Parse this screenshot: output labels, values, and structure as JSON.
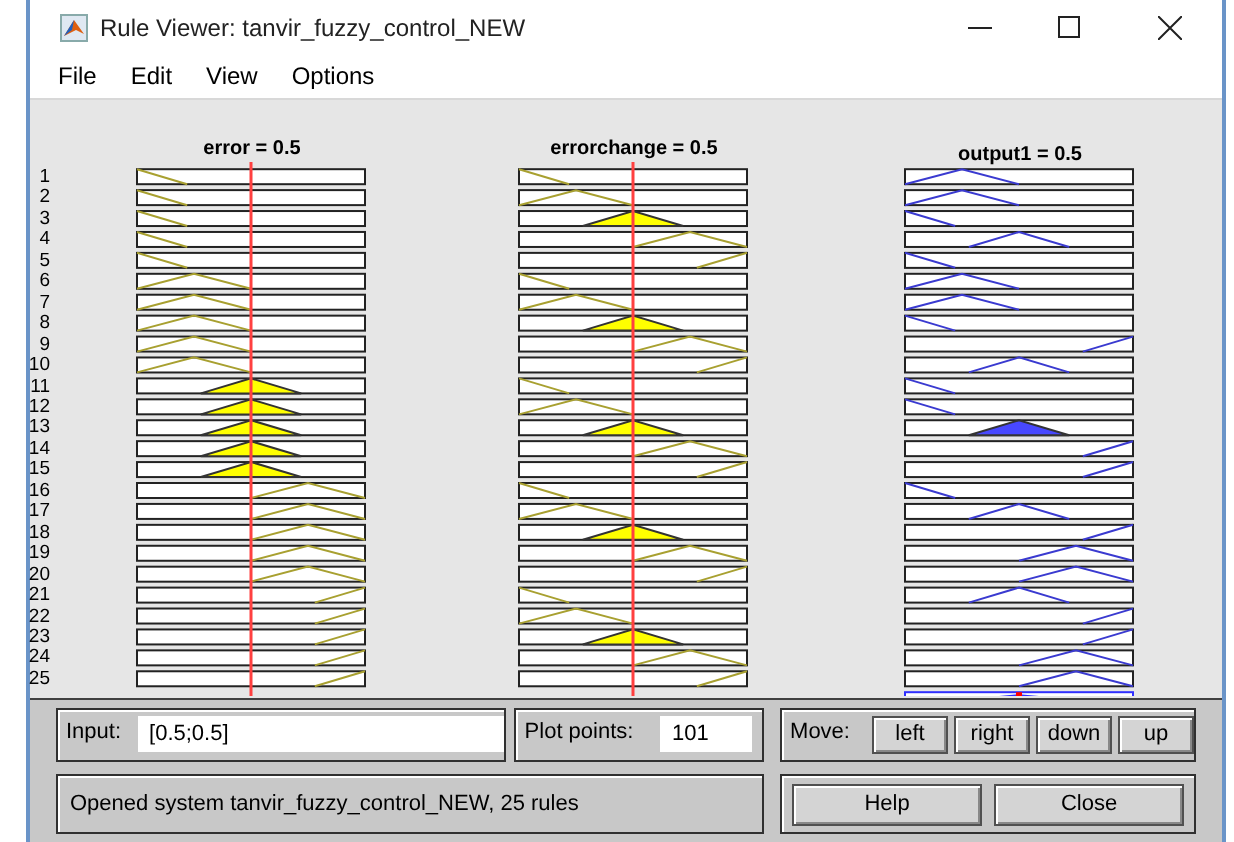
{
  "window": {
    "title": "Rule Viewer: tanvir_fuzzy_control_NEW"
  },
  "menu": [
    "File",
    "Edit",
    "View",
    "Options"
  ],
  "variables": [
    {
      "label": "error = 0.5",
      "kind": "input",
      "rules": [
        {
          "kind": "low",
          "filled": false
        },
        {
          "kind": "low",
          "filled": false
        },
        {
          "kind": "low",
          "filled": false
        },
        {
          "kind": "low",
          "filled": false
        },
        {
          "kind": "low",
          "filled": false
        },
        {
          "kind": "low-mid",
          "filled": false
        },
        {
          "kind": "low-mid",
          "filled": false
        },
        {
          "kind": "low-mid",
          "filled": false
        },
        {
          "kind": "low-mid",
          "filled": false
        },
        {
          "kind": "low-mid",
          "filled": false
        },
        {
          "kind": "mid",
          "filled": true
        },
        {
          "kind": "mid",
          "filled": true
        },
        {
          "kind": "mid",
          "filled": true
        },
        {
          "kind": "mid",
          "filled": true
        },
        {
          "kind": "mid",
          "filled": true
        },
        {
          "kind": "high-mid",
          "filled": false
        },
        {
          "kind": "high-mid",
          "filled": false
        },
        {
          "kind": "high-mid",
          "filled": false
        },
        {
          "kind": "high-mid",
          "filled": false
        },
        {
          "kind": "high-mid",
          "filled": false
        },
        {
          "kind": "high",
          "filled": false
        },
        {
          "kind": "high",
          "filled": false
        },
        {
          "kind": "high",
          "filled": false
        },
        {
          "kind": "high",
          "filled": false
        },
        {
          "kind": "high",
          "filled": false
        }
      ]
    },
    {
      "label": "errorchange = 0.5",
      "kind": "input",
      "rules": [
        {
          "kind": "low",
          "filled": false
        },
        {
          "kind": "low-mid",
          "filled": false
        },
        {
          "kind": "mid",
          "filled": true
        },
        {
          "kind": "high-mid",
          "filled": false
        },
        {
          "kind": "high",
          "filled": false
        },
        {
          "kind": "low",
          "filled": false
        },
        {
          "kind": "low-mid",
          "filled": false
        },
        {
          "kind": "mid",
          "filled": true
        },
        {
          "kind": "high-mid",
          "filled": false
        },
        {
          "kind": "high",
          "filled": false
        },
        {
          "kind": "low",
          "filled": false
        },
        {
          "kind": "low-mid",
          "filled": false
        },
        {
          "kind": "mid",
          "filled": true
        },
        {
          "kind": "high-mid",
          "filled": false
        },
        {
          "kind": "high",
          "filled": false
        },
        {
          "kind": "low",
          "filled": false
        },
        {
          "kind": "low-mid",
          "filled": false
        },
        {
          "kind": "mid",
          "filled": true
        },
        {
          "kind": "high-mid",
          "filled": false
        },
        {
          "kind": "high",
          "filled": false
        },
        {
          "kind": "low",
          "filled": false
        },
        {
          "kind": "low-mid",
          "filled": false
        },
        {
          "kind": "mid",
          "filled": true
        },
        {
          "kind": "high-mid",
          "filled": false
        },
        {
          "kind": "high",
          "filled": false
        }
      ]
    },
    {
      "label": "output1 = 0.5",
      "kind": "output",
      "level": 0.5,
      "rules": [
        {
          "kind": "low-mid",
          "filled": false
        },
        {
          "kind": "low-mid",
          "filled": false
        },
        {
          "kind": "low",
          "filled": false
        },
        {
          "kind": "mid",
          "filled": false
        },
        {
          "kind": "low",
          "filled": false
        },
        {
          "kind": "low-mid",
          "filled": false
        },
        {
          "kind": "low-mid",
          "filled": false
        },
        {
          "kind": "low",
          "filled": false
        },
        {
          "kind": "high",
          "filled": false
        },
        {
          "kind": "mid",
          "filled": false
        },
        {
          "kind": "low",
          "filled": false
        },
        {
          "kind": "low",
          "filled": false
        },
        {
          "kind": "mid",
          "filled": true
        },
        {
          "kind": "high",
          "filled": false
        },
        {
          "kind": "high",
          "filled": false
        },
        {
          "kind": "low",
          "filled": false
        },
        {
          "kind": "mid",
          "filled": false
        },
        {
          "kind": "high",
          "filled": false
        },
        {
          "kind": "high-mid",
          "filled": false
        },
        {
          "kind": "high-mid",
          "filled": false
        },
        {
          "kind": "mid",
          "filled": false
        },
        {
          "kind": "high",
          "filled": false
        },
        {
          "kind": "high",
          "filled": false
        },
        {
          "kind": "high-mid",
          "filled": false
        },
        {
          "kind": "high-mid",
          "filled": false
        }
      ]
    }
  ],
  "rule_numbers": [
    "1",
    "2",
    "3",
    "4",
    "5",
    "6",
    "7",
    "8",
    "9",
    "10",
    "11",
    "12",
    "13",
    "14",
    "15",
    "16",
    "17",
    "18",
    "19",
    "20",
    "21",
    "22",
    "23",
    "24",
    "25"
  ],
  "input": {
    "label": "Input:",
    "value": "[0.5;0.5]"
  },
  "plot_points": {
    "label": "Plot points:",
    "value": "101"
  },
  "move": {
    "label": "Move:",
    "buttons": [
      "left",
      "right",
      "down",
      "up"
    ]
  },
  "status": "Opened system tanvir_fuzzy_control_NEW, 25 rules",
  "buttons": [
    "Help",
    "Close"
  ]
}
